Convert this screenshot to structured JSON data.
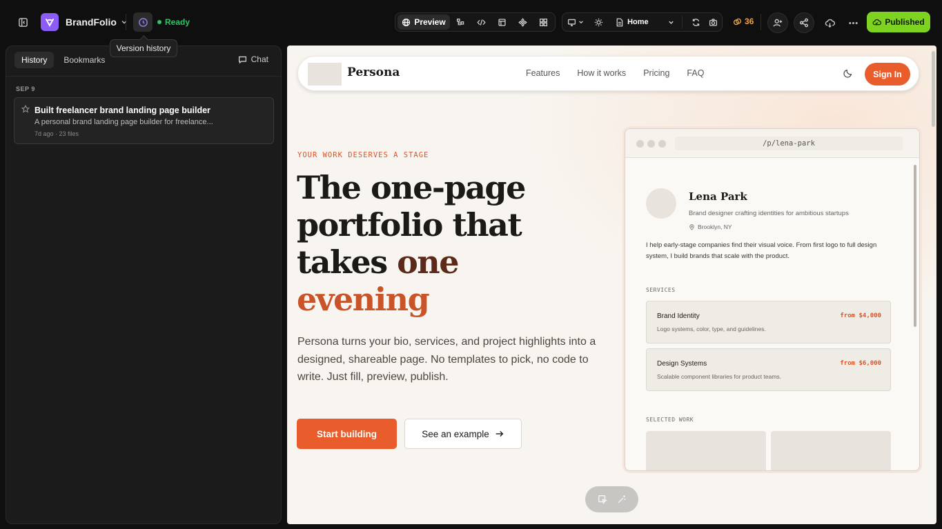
{
  "app": {
    "brand": "BrandFolio",
    "status": "Ready",
    "tooltip": "Version history",
    "toolbar": {
      "preview_label": "Preview",
      "page_select": "Home",
      "credits": "36",
      "publish_label": "Published"
    },
    "colors": {
      "accent": "#8b5cf6",
      "published": "#7ed321",
      "ready": "#35c26a",
      "credits": "#f0a33c"
    }
  },
  "sidebar": {
    "tabs": [
      {
        "label": "History",
        "active": true
      },
      {
        "label": "Bookmarks",
        "active": false
      }
    ],
    "chat_label": "Chat",
    "date_header": "SEP 9",
    "history": [
      {
        "title": "Built freelancer brand landing page builder",
        "description": "A personal brand landing page builder for freelance...",
        "meta": "7d ago · 23 files"
      }
    ]
  },
  "preview": {
    "nav": {
      "brand": "Persona",
      "links": [
        "Features",
        "How it works",
        "Pricing",
        "FAQ"
      ],
      "signin": "Sign In"
    },
    "eyebrow": "YOUR WORK DESERVES A STAGE",
    "hero": {
      "line1": "The one-page",
      "line2": "portfolio that",
      "line3": "takes ",
      "accent1": "one",
      "accent2": "evening"
    },
    "subtitle": "Persona turns your bio, services, and project highlights into a designed, shareable page. No templates to pick, no code to write. Just fill, preview, publish.",
    "cta_primary": "Start building",
    "cta_secondary": "See an example",
    "mock": {
      "url": "/p/lena-park",
      "name": "Lena Park",
      "role": "Brand designer crafting identities for ambitious startups",
      "location": "Brooklyn, NY",
      "bio": "I help early-stage companies find their visual voice. From first logo to full design system, I build brands that scale with the product.",
      "services_header": "SERVICES",
      "services": [
        {
          "name": "Brand Identity",
          "price": "from $4,000",
          "desc": "Logo systems, color, type, and guidelines."
        },
        {
          "name": "Design Systems",
          "price": "from $6,000",
          "desc": "Scalable component libraries for product teams."
        }
      ],
      "work_header": "SELECTED WORK"
    },
    "colors": {
      "orange": "#e85d2b",
      "background": "#f8f5f0"
    }
  }
}
